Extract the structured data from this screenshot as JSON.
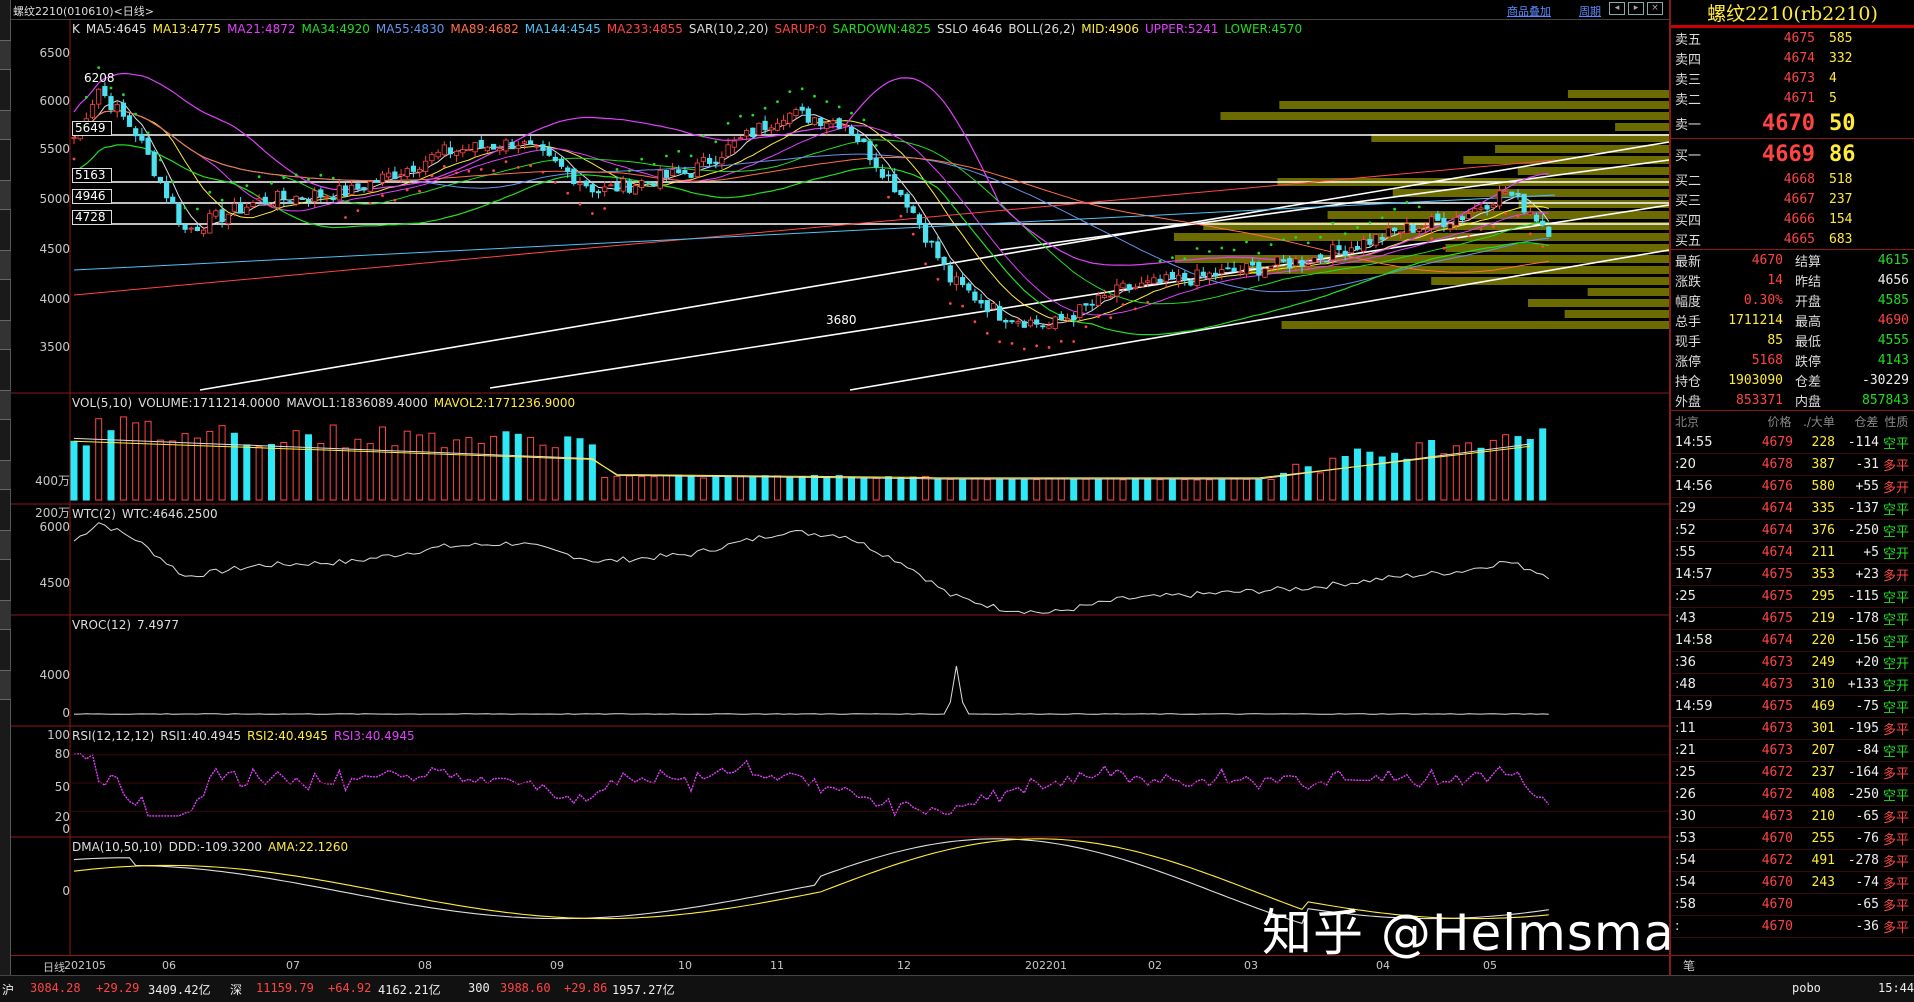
{
  "window": {
    "title": "螺纹2210(010610)<日线>",
    "link_overlay": "商品叠加",
    "link_period": "周期"
  },
  "legends": {
    "main": [
      {
        "text": "K",
        "color": "#dddddd"
      },
      {
        "text": "MA5:4645",
        "color": "#dddddd"
      },
      {
        "text": "MA13:4775",
        "color": "#ffeb3b"
      },
      {
        "text": "MA21:4872",
        "color": "#e040fb"
      },
      {
        "text": "MA34:4920",
        "color": "#22dd22"
      },
      {
        "text": "MA55:4830",
        "color": "#6495ed"
      },
      {
        "text": "MA89:4682",
        "color": "#ff7043"
      },
      {
        "text": "MA144:4545",
        "color": "#4fc3f7"
      },
      {
        "text": "MA233:4855",
        "color": "#ff4444"
      },
      {
        "text": "SAR(10,2,20)",
        "color": "#dddddd"
      },
      {
        "text": "SARUP:0",
        "color": "#ff4444"
      },
      {
        "text": "SARDOWN:4825",
        "color": "#22dd22"
      },
      {
        "text": "SSLO 4646",
        "color": "#dddddd"
      },
      {
        "text": "BOLL(26,2)",
        "color": "#dddddd"
      },
      {
        "text": "MID:4906",
        "color": "#ffeb3b"
      },
      {
        "text": "UPPER:5241",
        "color": "#e040fb"
      },
      {
        "text": "LOWER:4570",
        "color": "#22dd22"
      }
    ],
    "vol": [
      {
        "text": "VOL(5,10)",
        "color": "#dddddd"
      },
      {
        "text": "VOLUME:1711214.0000",
        "color": "#dddddd"
      },
      {
        "text": "MAVOL1:1836089.4000",
        "color": "#dddddd"
      },
      {
        "text": "MAVOL2:1771236.9000",
        "color": "#ffeb3b"
      }
    ],
    "wtc": [
      {
        "text": "WTC(2)",
        "color": "#dddddd"
      },
      {
        "text": "WTC:4646.2500",
        "color": "#dddddd"
      }
    ],
    "vroc": [
      {
        "text": "VROC(12)",
        "color": "#dddddd"
      },
      {
        "text": "7.4977",
        "color": "#dddddd"
      }
    ],
    "rsi": [
      {
        "text": "RSI(12,12,12)",
        "color": "#dddddd"
      },
      {
        "text": "RSI1:40.4945",
        "color": "#dddddd"
      },
      {
        "text": "RSI2:40.4945",
        "color": "#ffeb3b"
      },
      {
        "text": "RSI3:40.4945",
        "color": "#e040fb"
      }
    ],
    "dma": [
      {
        "text": "DMA(10,50,10)",
        "color": "#dddddd"
      },
      {
        "text": "DDD:-109.3200",
        "color": "#dddddd"
      },
      {
        "text": "AMA:22.1260",
        "color": "#ffeb3b"
      }
    ]
  },
  "axes": {
    "main": [
      "6500",
      "6000",
      "5500",
      "5000",
      "4500",
      "4000",
      "3500"
    ],
    "vol": [
      "400万",
      "200万"
    ],
    "wtc": [
      "6000",
      "4500"
    ],
    "vroc": [
      "4000",
      "0"
    ],
    "rsi": [
      "100",
      "80",
      "50",
      "20",
      "0"
    ],
    "dma": [
      "0"
    ]
  },
  "price_labels": {
    "high": "6208",
    "low": "3680",
    "boxes": [
      "5649",
      "5163",
      "4946",
      "4728"
    ]
  },
  "x_axis": {
    "label": "日线",
    "ticks": [
      "202105",
      "06",
      "07",
      "08",
      "09",
      "10",
      "11",
      "12",
      "202201",
      "02",
      "03",
      "04",
      "05"
    ]
  },
  "contract": "螺纹2210(rb2210)",
  "orderbook": {
    "asks": [
      {
        "label": "卖五",
        "price": "4675",
        "vol": "585"
      },
      {
        "label": "卖四",
        "price": "4674",
        "vol": "332"
      },
      {
        "label": "卖三",
        "price": "4673",
        "vol": "4"
      },
      {
        "label": "卖二",
        "price": "4671",
        "vol": "5"
      },
      {
        "label": "卖一",
        "price": "4670",
        "vol": "50"
      }
    ],
    "bids": [
      {
        "label": "买一",
        "price": "4669",
        "vol": "86"
      },
      {
        "label": "买二",
        "price": "4668",
        "vol": "518"
      },
      {
        "label": "买三",
        "price": "4667",
        "vol": "237"
      },
      {
        "label": "买四",
        "price": "4666",
        "vol": "154"
      },
      {
        "label": "买五",
        "price": "4665",
        "vol": "683"
      }
    ]
  },
  "stats": [
    {
      "l1": "最新",
      "v1": "4670",
      "c1": "red",
      "l2": "结算",
      "v2": "4615",
      "c2": "green"
    },
    {
      "l1": "涨跌",
      "v1": "14",
      "c1": "red",
      "l2": "昨结",
      "v2": "4656",
      "c2": "white"
    },
    {
      "l1": "幅度",
      "v1": "0.30%",
      "c1": "red",
      "l2": "开盘",
      "v2": "4585",
      "c2": "green"
    },
    {
      "l1": "总手",
      "v1": "1711214",
      "c1": "yellow",
      "l2": "最高",
      "v2": "4690",
      "c2": "red"
    },
    {
      "l1": "现手",
      "v1": "85",
      "c1": "yellow",
      "l2": "最低",
      "v2": "4555",
      "c2": "green"
    },
    {
      "l1": "涨停",
      "v1": "5168",
      "c1": "red",
      "l2": "跌停",
      "v2": "4143",
      "c2": "green"
    },
    {
      "l1": "持仓",
      "v1": "1903090",
      "c1": "yellow",
      "l2": "仓差",
      "v2": "-30229",
      "c2": "white"
    },
    {
      "l1": "外盘",
      "v1": "853371",
      "c1": "red",
      "l2": "内盘",
      "v2": "857843",
      "c2": "green"
    }
  ],
  "tick_header": [
    "北京",
    "价格",
    "./大单",
    "仓差",
    "性质"
  ],
  "ticks": [
    {
      "t": "14:55",
      "p": "4679",
      "v": "228",
      "o": "-114",
      "oc": "white",
      "n": "空平",
      "nc": "green"
    },
    {
      "t": ":20",
      "p": "4678",
      "v": "387",
      "o": "-31",
      "oc": "white",
      "n": "多平",
      "nc": "red"
    },
    {
      "t": "14:56",
      "p": "4676",
      "v": "580",
      "o": "+55",
      "oc": "white",
      "n": "多开",
      "nc": "red"
    },
    {
      "t": ":29",
      "p": "4674",
      "v": "335",
      "o": "-137",
      "oc": "white",
      "n": "空平",
      "nc": "green"
    },
    {
      "t": ":52",
      "p": "4674",
      "v": "376",
      "o": "-250",
      "oc": "white",
      "n": "空平",
      "nc": "green"
    },
    {
      "t": ":55",
      "p": "4674",
      "v": "211",
      "o": "+5",
      "oc": "white",
      "n": "空开",
      "nc": "green"
    },
    {
      "t": "14:57",
      "p": "4675",
      "v": "353",
      "o": "+23",
      "oc": "white",
      "n": "多开",
      "nc": "red"
    },
    {
      "t": ":25",
      "p": "4675",
      "v": "295",
      "o": "-115",
      "oc": "white",
      "n": "空平",
      "nc": "green"
    },
    {
      "t": ":43",
      "p": "4675",
      "v": "219",
      "o": "-178",
      "oc": "white",
      "n": "空平",
      "nc": "green"
    },
    {
      "t": "14:58",
      "p": "4674",
      "v": "220",
      "o": "-156",
      "oc": "white",
      "n": "空平",
      "nc": "green"
    },
    {
      "t": ":36",
      "p": "4673",
      "v": "249",
      "o": "+20",
      "oc": "white",
      "n": "空开",
      "nc": "green"
    },
    {
      "t": ":48",
      "p": "4673",
      "v": "310",
      "o": "+133",
      "oc": "white",
      "n": "空开",
      "nc": "green"
    },
    {
      "t": "14:59",
      "p": "4675",
      "v": "469",
      "o": "-75",
      "oc": "white",
      "n": "空平",
      "nc": "green"
    },
    {
      "t": ":11",
      "p": "4673",
      "v": "301",
      "o": "-195",
      "oc": "white",
      "n": "多平",
      "nc": "red"
    },
    {
      "t": ":21",
      "p": "4673",
      "v": "207",
      "o": "-84",
      "oc": "white",
      "n": "空平",
      "nc": "green"
    },
    {
      "t": ":25",
      "p": "4672",
      "v": "237",
      "o": "-164",
      "oc": "white",
      "n": "多平",
      "nc": "red"
    },
    {
      "t": ":26",
      "p": "4672",
      "v": "408",
      "o": "-250",
      "oc": "white",
      "n": "空平",
      "nc": "green"
    },
    {
      "t": ":30",
      "p": "4673",
      "v": "210",
      "o": "-65",
      "oc": "white",
      "n": "多平",
      "nc": "red"
    },
    {
      "t": ":53",
      "p": "4670",
      "v": "255",
      "o": "-76",
      "oc": "white",
      "n": "多平",
      "nc": "red"
    },
    {
      "t": ":54",
      "p": "4672",
      "v": "491",
      "o": "-278",
      "oc": "white",
      "n": "多平",
      "nc": "red"
    },
    {
      "t": ":54",
      "p": "4670",
      "v": "243",
      "o": "-74",
      "oc": "white",
      "n": "多平",
      "nc": "red"
    },
    {
      "t": ":58",
      "p": "4670",
      "v": "",
      "o": "-65",
      "oc": "white",
      "n": "多平",
      "nc": "red"
    },
    {
      "t": ":",
      "p": "4670",
      "v": "",
      "o": "-36",
      "oc": "white",
      "n": "多平",
      "nc": "red"
    }
  ],
  "tick_footer": "笔",
  "statusbar": [
    {
      "text": "沪",
      "c": "white"
    },
    {
      "text": "3084.28",
      "c": "red"
    },
    {
      "text": "+29.29",
      "c": "red"
    },
    {
      "text": "3409.42亿",
      "c": "white"
    },
    {
      "text": "深",
      "c": "white"
    },
    {
      "text": "11159.79",
      "c": "red"
    },
    {
      "text": "+64.92",
      "c": "red"
    },
    {
      "text": "4162.21亿",
      "c": "white"
    },
    {
      "text": "300",
      "c": "white"
    },
    {
      "text": "3988.60",
      "c": "red"
    },
    {
      "text": "+29.86",
      "c": "red"
    },
    {
      "text": "1957.27亿",
      "c": "white"
    },
    {
      "text": "pobo",
      "c": "white"
    },
    {
      "text": "15:44",
      "c": "white"
    }
  ],
  "watermark": "知乎 @Helmsman-MAX"
}
